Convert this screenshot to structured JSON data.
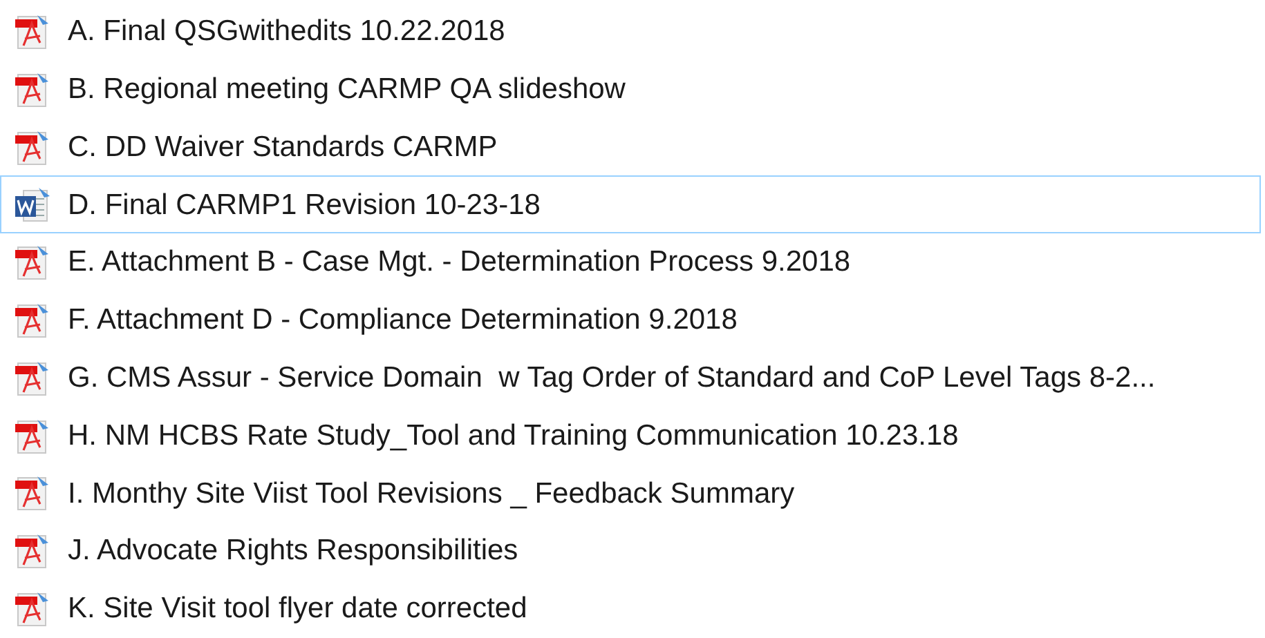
{
  "files": [
    {
      "kind": "pdf",
      "name": "A. Final QSGwithedits 10.22.2018",
      "selected": false
    },
    {
      "kind": "pdf",
      "name": "B. Regional meeting CARMP QA slideshow",
      "selected": false
    },
    {
      "kind": "pdf",
      "name": "C. DD Waiver Standards CARMP",
      "selected": false
    },
    {
      "kind": "word",
      "name": "D. Final CARMP1 Revision 10-23-18",
      "selected": true
    },
    {
      "kind": "pdf",
      "name": "E. Attachment B - Case Mgt. - Determination Process 9.2018",
      "selected": false
    },
    {
      "kind": "pdf",
      "name": "F. Attachment D - Compliance Determination 9.2018",
      "selected": false
    },
    {
      "kind": "pdf",
      "name": "G. CMS Assur - Service Domain  w Tag Order of Standard and CoP Level Tags 8-2...",
      "selected": false
    },
    {
      "kind": "pdf",
      "name": "H. NM HCBS Rate Study_Tool and Training Communication 10.23.18",
      "selected": false
    },
    {
      "kind": "pdf",
      "name": "I. Monthy Site Viist Tool Revisions _ Feedback Summary",
      "selected": false
    },
    {
      "kind": "pdf",
      "name": "J. Advocate Rights Responsibilities",
      "selected": false
    },
    {
      "kind": "pdf",
      "name": "K. Site Visit tool flyer date corrected",
      "selected": false
    }
  ]
}
